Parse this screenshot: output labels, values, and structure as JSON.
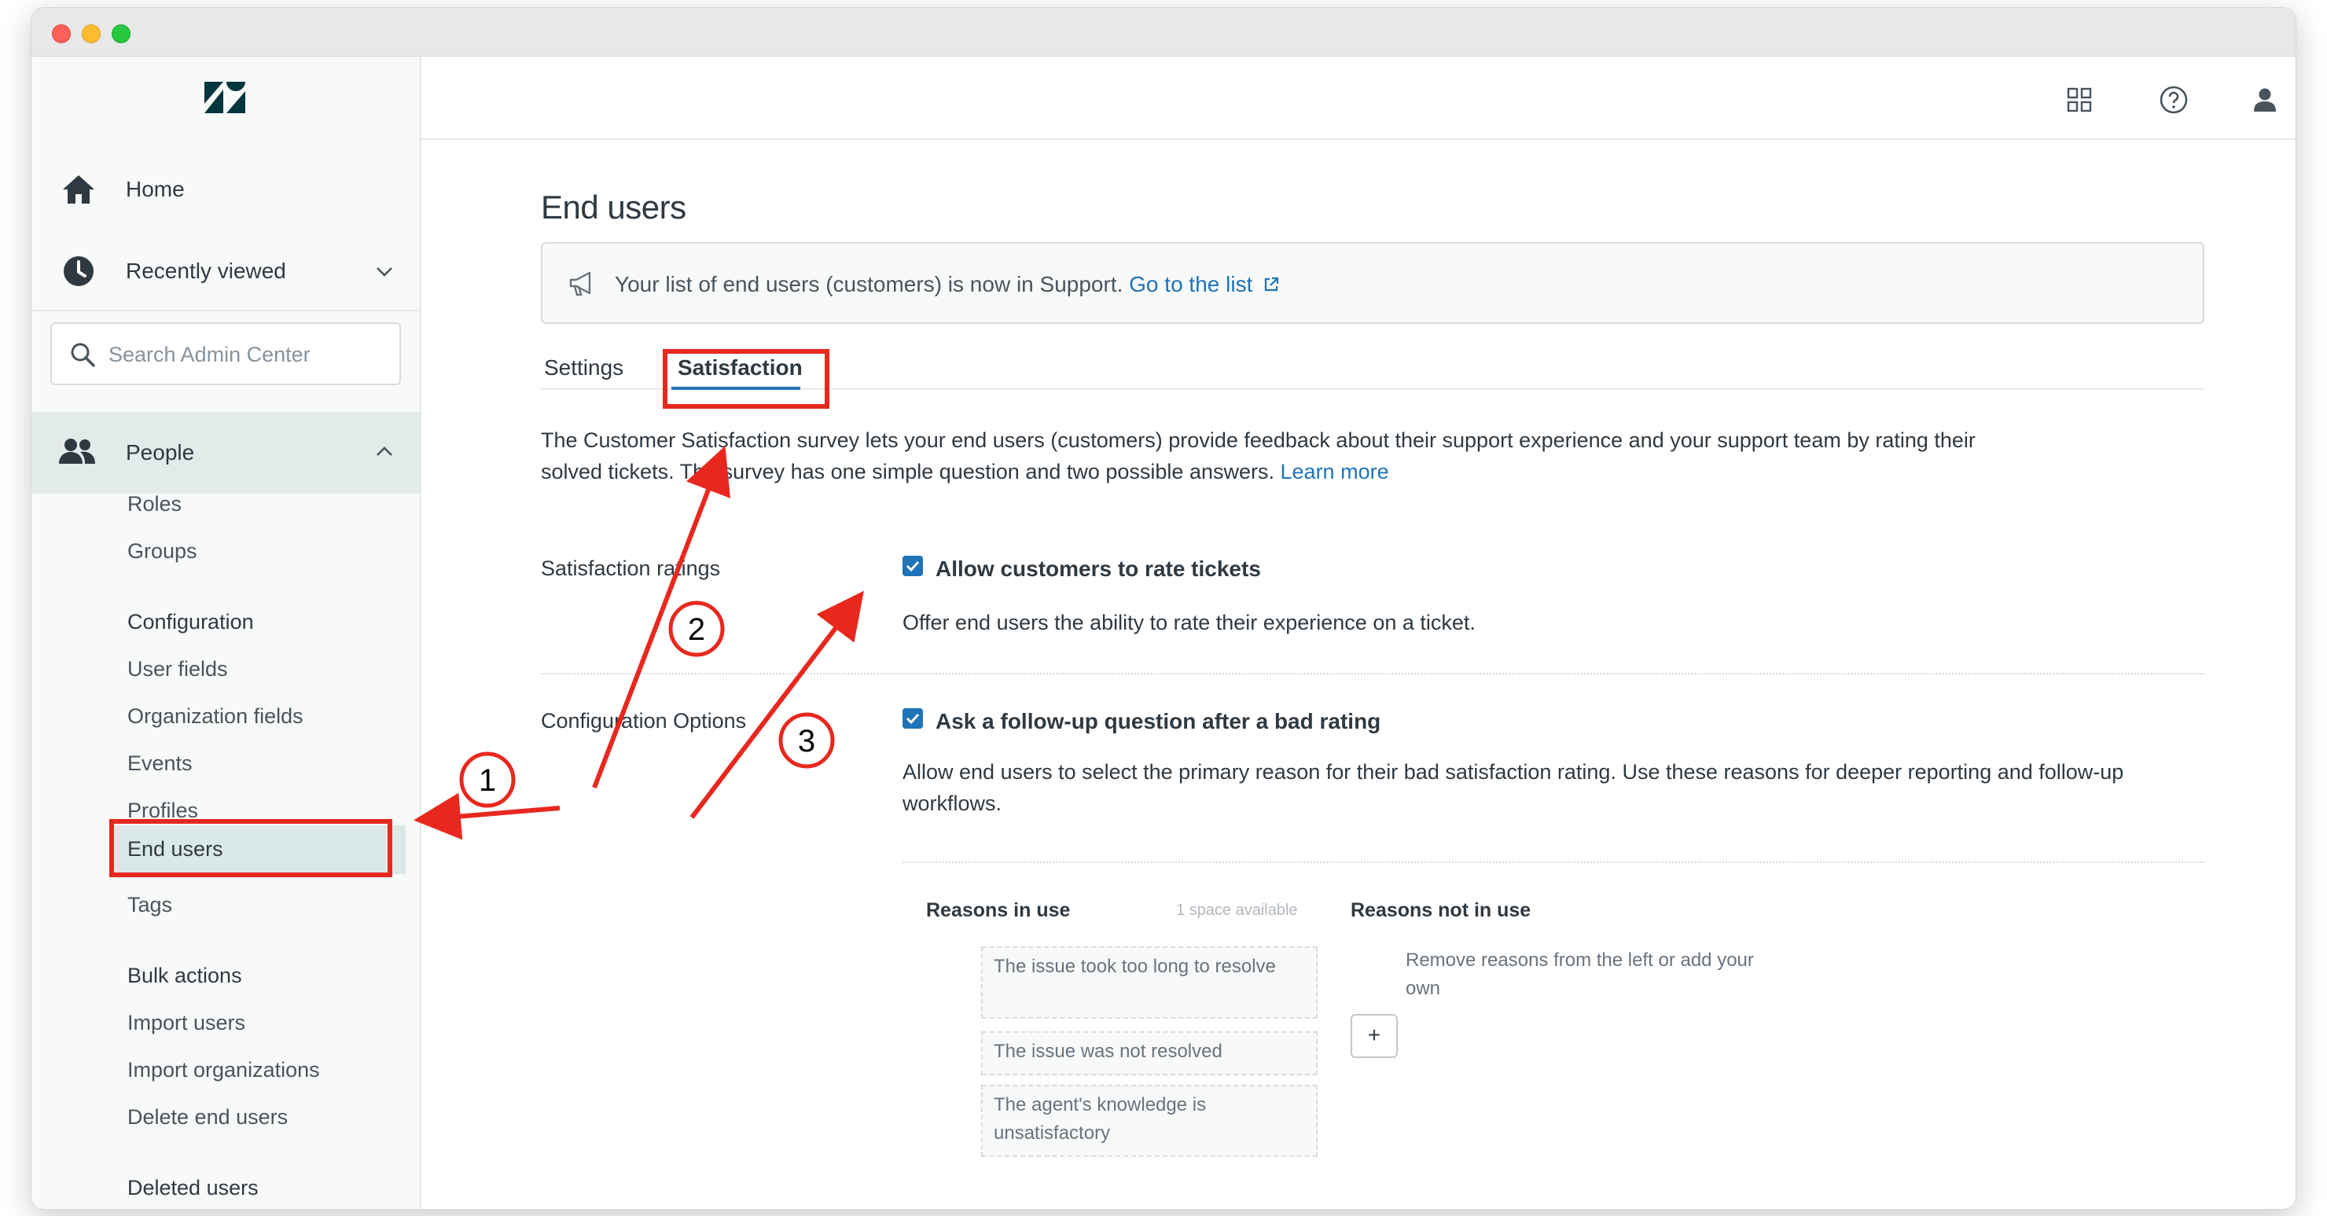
{
  "sidebar": {
    "home": "Home",
    "recently_viewed": "Recently viewed",
    "search_placeholder": "Search Admin Center",
    "people": "People",
    "items": [
      "Roles",
      "Groups"
    ],
    "configuration_heading": "Configuration",
    "configuration_items": [
      "User fields",
      "Organization fields",
      "Events",
      "Profiles",
      "End users",
      "Tags"
    ],
    "bulk_heading": "Bulk actions",
    "bulk_items": [
      "Import users",
      "Import organizations",
      "Delete end users"
    ],
    "deleted_heading": "Deleted users"
  },
  "page": {
    "title": "End users",
    "notice_text": "Your list of end users (customers) is now in Support.",
    "notice_link": "Go to the list",
    "tabs": [
      "Settings",
      "Satisfaction"
    ],
    "description": "The Customer Satisfaction survey lets your end users (customers) provide feedback about their support experience and your support team by rating their solved tickets. The survey has one simple question and two possible answers.",
    "learn_more": "Learn more",
    "ratings_label": "Satisfaction ratings",
    "allow_label": "Allow customers to rate tickets",
    "allow_hint": "Offer end users the ability to rate their experience on a ticket.",
    "config_label": "Configuration Options",
    "followup_label": "Ask a follow-up question after a bad rating",
    "followup_hint": "Allow end users to select the primary reason for their bad satisfaction rating. Use these reasons for deeper reporting and follow-up workflows.",
    "reasons_in_use": "Reasons in use",
    "space_available": "1 space available",
    "reasons_not_in_use": "Reasons not in use",
    "reasons": [
      "The issue took too long to resolve",
      "The issue was not resolved",
      "The agent's knowledge is unsatisfactory"
    ],
    "not_in_use_hint": "Remove reasons from the left or add your own",
    "add_button": "+"
  },
  "annotations": [
    "1",
    "2",
    "3"
  ],
  "colors": {
    "accent": "#1f73b7",
    "annotation": "#e8281e",
    "sidebar_active": "#e3eaea"
  }
}
